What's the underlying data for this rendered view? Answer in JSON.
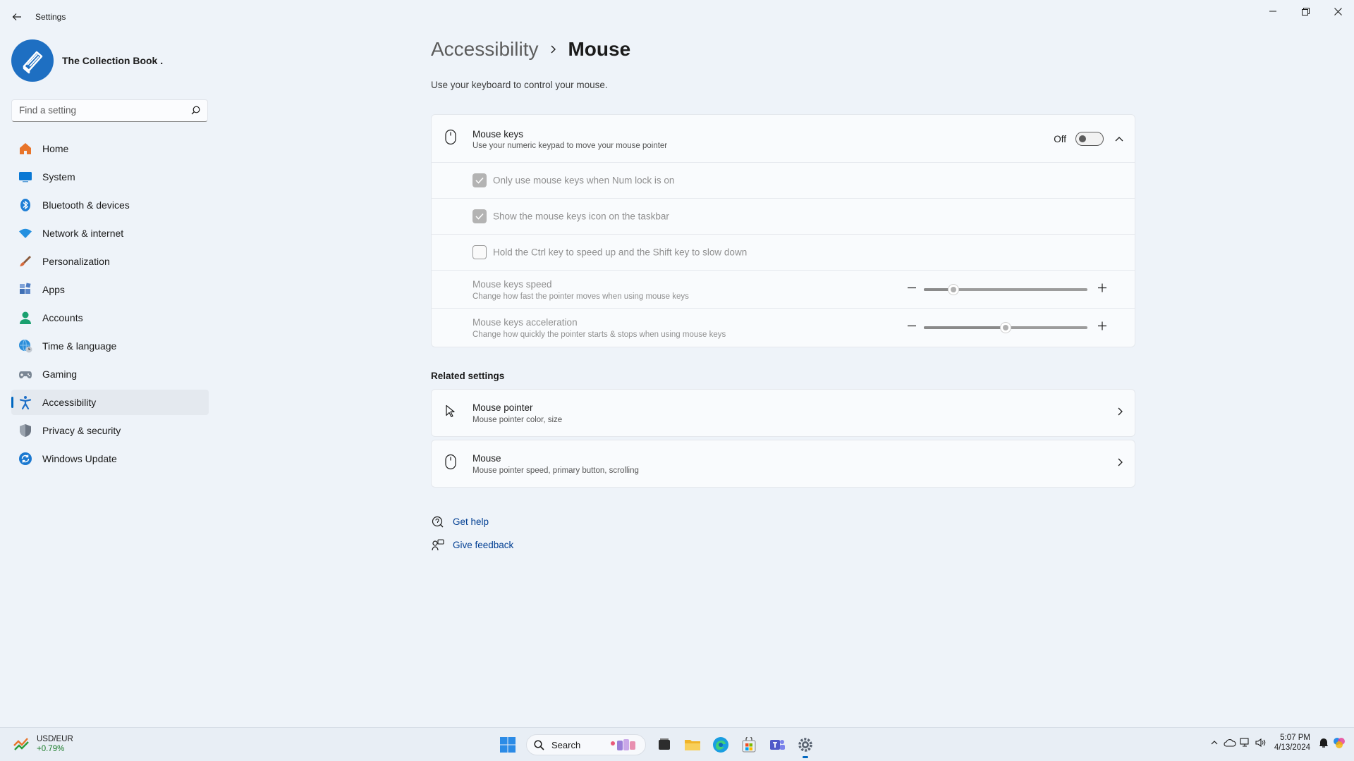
{
  "window": {
    "title": "Settings"
  },
  "profile": {
    "name": "The Collection Book ."
  },
  "search": {
    "placeholder": "Find a setting"
  },
  "nav": {
    "items": [
      {
        "label": "Home",
        "icon": "home-icon",
        "color": "#e8742a"
      },
      {
        "label": "System",
        "icon": "monitor-icon",
        "color": "#0a78d4"
      },
      {
        "label": "Bluetooth & devices",
        "icon": "bluetooth-icon",
        "color": "#1f7fd6"
      },
      {
        "label": "Network & internet",
        "icon": "wifi-icon",
        "color": "#2490e0"
      },
      {
        "label": "Personalization",
        "icon": "brush-icon",
        "color": "#d86a3c"
      },
      {
        "label": "Apps",
        "icon": "apps-icon",
        "color": "#3f6fb5"
      },
      {
        "label": "Accounts",
        "icon": "person-icon",
        "color": "#1aa06f"
      },
      {
        "label": "Time & language",
        "icon": "globe-clock-icon",
        "color": "#2a8dd8"
      },
      {
        "label": "Gaming",
        "icon": "gamepad-icon",
        "color": "#7a8694"
      },
      {
        "label": "Accessibility",
        "icon": "accessibility-icon",
        "color": "#1d6fc7"
      },
      {
        "label": "Privacy & security",
        "icon": "shield-icon",
        "color": "#6d7683"
      },
      {
        "label": "Windows Update",
        "icon": "update-icon",
        "color": "#1a78d0"
      }
    ],
    "active_index": 9
  },
  "breadcrumb": {
    "parent": "Accessibility",
    "current": "Mouse"
  },
  "page": {
    "description": "Use your keyboard to control your mouse."
  },
  "mouse_keys": {
    "title": "Mouse keys",
    "subtitle": "Use your numeric keypad to move your mouse pointer",
    "toggle_state": "Off",
    "options": [
      {
        "label": "Only use mouse keys when Num lock is on",
        "checked": true
      },
      {
        "label": "Show the mouse keys icon on the taskbar",
        "checked": true
      },
      {
        "label": "Hold the Ctrl key to speed up and the Shift key to slow down",
        "checked": false
      }
    ],
    "speed": {
      "title": "Mouse keys speed",
      "subtitle": "Change how fast the pointer moves when using mouse keys",
      "value_fraction": 0.18
    },
    "acceleration": {
      "title": "Mouse keys acceleration",
      "subtitle": "Change how quickly the pointer starts & stops when using mouse keys",
      "value_fraction": 0.5
    }
  },
  "related": {
    "title": "Related settings",
    "items": [
      {
        "title": "Mouse pointer",
        "subtitle": "Mouse pointer color, size",
        "icon": "pointer-icon"
      },
      {
        "title": "Mouse",
        "subtitle": "Mouse pointer speed, primary button, scrolling",
        "icon": "mouse-icon"
      }
    ]
  },
  "links": {
    "help": "Get help",
    "feedback": "Give feedback"
  },
  "taskbar": {
    "widget_title": "USD/EUR",
    "widget_change": "+0.79%",
    "search_label": "Search",
    "time": "5:07 PM",
    "date": "4/13/2024"
  }
}
